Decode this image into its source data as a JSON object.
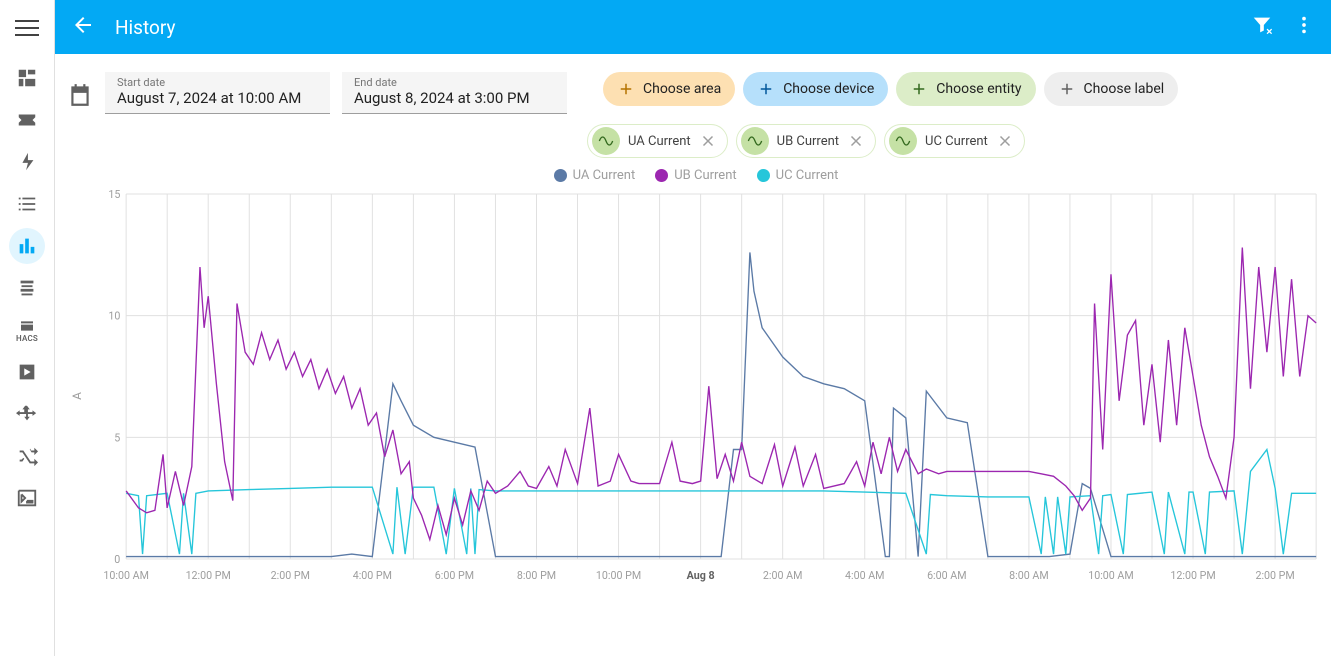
{
  "header": {
    "title": "History"
  },
  "dates": {
    "start_label": "Start date",
    "start_value": "August 7, 2024 at 10:00 AM",
    "end_label": "End date",
    "end_value": "August 8, 2024 at 3:00 PM"
  },
  "filters": {
    "area": "Choose area",
    "device": "Choose device",
    "entity": "Choose entity",
    "label": "Choose label"
  },
  "entity_chips": [
    "UA Current",
    "UB Current",
    "UC Current"
  ],
  "legend": [
    {
      "label": "UA Current",
      "color": "#5b7aa6"
    },
    {
      "label": "UB Current",
      "color": "#9c27b0"
    },
    {
      "label": "UC Current",
      "color": "#26c6da"
    }
  ],
  "chart_data": {
    "type": "line",
    "ylabel": "A",
    "ylim": [
      0,
      15
    ],
    "yticks": [
      0,
      5,
      10,
      15
    ],
    "x_hours_start": 10,
    "x_hours_end": 39,
    "xticks": [
      {
        "h": 10,
        "label": "10:00 AM"
      },
      {
        "h": 12,
        "label": "12:00 PM"
      },
      {
        "h": 14,
        "label": "2:00 PM"
      },
      {
        "h": 16,
        "label": "4:00 PM"
      },
      {
        "h": 18,
        "label": "6:00 PM"
      },
      {
        "h": 20,
        "label": "8:00 PM"
      },
      {
        "h": 22,
        "label": "10:00 PM"
      },
      {
        "h": 24,
        "label": "Aug 8",
        "bold": true
      },
      {
        "h": 26,
        "label": "2:00 AM"
      },
      {
        "h": 28,
        "label": "4:00 AM"
      },
      {
        "h": 30,
        "label": "6:00 AM"
      },
      {
        "h": 32,
        "label": "8:00 AM"
      },
      {
        "h": 34,
        "label": "10:00 AM"
      },
      {
        "h": 36,
        "label": "12:00 PM"
      },
      {
        "h": 38,
        "label": "2:00 PM"
      }
    ],
    "series": [
      {
        "name": "UA Current",
        "color": "#5b7aa6",
        "data": [
          [
            10,
            0.1
          ],
          [
            15,
            0.1
          ],
          [
            15.5,
            0.2
          ],
          [
            16,
            0.1
          ],
          [
            16.5,
            7.2
          ],
          [
            16.7,
            6.5
          ],
          [
            17,
            5.5
          ],
          [
            17.5,
            5
          ],
          [
            18,
            4.8
          ],
          [
            18.5,
            4.6
          ],
          [
            19,
            0.1
          ],
          [
            24.5,
            0.1
          ],
          [
            24.8,
            4.5
          ],
          [
            25,
            4.5
          ],
          [
            25.2,
            12.6
          ],
          [
            25.3,
            11
          ],
          [
            25.5,
            9.5
          ],
          [
            26,
            8.3
          ],
          [
            26.5,
            7.5
          ],
          [
            27,
            7.2
          ],
          [
            27.5,
            7
          ],
          [
            28,
            6.5
          ],
          [
            28.5,
            0.1
          ],
          [
            28.6,
            0.1
          ],
          [
            28.7,
            6.2
          ],
          [
            29,
            5.8
          ],
          [
            29.3,
            0.1
          ],
          [
            29.5,
            6.9
          ],
          [
            30,
            5.8
          ],
          [
            30.5,
            5.6
          ],
          [
            31,
            0.1
          ],
          [
            32.5,
            0.1
          ],
          [
            33,
            0.2
          ],
          [
            33.3,
            3.1
          ],
          [
            33.5,
            2.9
          ],
          [
            34,
            0.1
          ],
          [
            39,
            0.1
          ]
        ]
      },
      {
        "name": "UC Current",
        "color": "#26c6da",
        "data": [
          [
            10,
            2.7
          ],
          [
            10.3,
            2.6
          ],
          [
            10.4,
            0.2
          ],
          [
            10.5,
            2.6
          ],
          [
            11,
            2.7
          ],
          [
            11.3,
            0.2
          ],
          [
            11.4,
            2.7
          ],
          [
            11.6,
            0.2
          ],
          [
            11.7,
            2.7
          ],
          [
            12,
            2.8
          ],
          [
            13,
            2.85
          ],
          [
            14,
            2.9
          ],
          [
            15,
            2.95
          ],
          [
            16,
            2.95
          ],
          [
            16.5,
            0.2
          ],
          [
            16.6,
            2.95
          ],
          [
            16.8,
            0.2
          ],
          [
            17,
            2.95
          ],
          [
            17.5,
            2.95
          ],
          [
            17.8,
            0.2
          ],
          [
            18,
            2.9
          ],
          [
            18.3,
            0.2
          ],
          [
            18.4,
            2.9
          ],
          [
            18.5,
            0.2
          ],
          [
            18.6,
            2.85
          ],
          [
            19,
            2.8
          ],
          [
            20,
            2.8
          ],
          [
            21,
            2.8
          ],
          [
            22,
            2.8
          ],
          [
            23,
            2.8
          ],
          [
            24,
            2.8
          ],
          [
            25,
            2.8
          ],
          [
            26,
            2.8
          ],
          [
            27,
            2.8
          ],
          [
            28,
            2.75
          ],
          [
            29,
            2.7
          ],
          [
            29.5,
            0.2
          ],
          [
            29.6,
            2.65
          ],
          [
            30,
            2.6
          ],
          [
            31,
            2.55
          ],
          [
            32,
            2.55
          ],
          [
            32.3,
            0.2
          ],
          [
            32.4,
            2.55
          ],
          [
            32.6,
            0.2
          ],
          [
            32.7,
            2.55
          ],
          [
            32.9,
            0.2
          ],
          [
            33,
            2.55
          ],
          [
            33.5,
            2.6
          ],
          [
            33.7,
            0.2
          ],
          [
            33.8,
            2.6
          ],
          [
            34,
            2.65
          ],
          [
            34.3,
            0.2
          ],
          [
            34.4,
            2.65
          ],
          [
            35,
            2.75
          ],
          [
            35.3,
            0.2
          ],
          [
            35.4,
            2.75
          ],
          [
            35.8,
            0.2
          ],
          [
            35.9,
            2.75
          ],
          [
            36,
            2.75
          ],
          [
            36.3,
            0.2
          ],
          [
            36.4,
            2.75
          ],
          [
            37,
            2.8
          ],
          [
            37.2,
            0.2
          ],
          [
            37.4,
            3.6
          ],
          [
            37.8,
            4.5
          ],
          [
            38,
            2.9
          ],
          [
            38.2,
            0.2
          ],
          [
            38.4,
            2.7
          ],
          [
            39,
            2.7
          ]
        ]
      },
      {
        "name": "UB Current",
        "color": "#9c27b0",
        "data": [
          [
            10,
            2.8
          ],
          [
            10.3,
            2.1
          ],
          [
            10.5,
            1.9
          ],
          [
            10.7,
            2.0
          ],
          [
            10.9,
            4.3
          ],
          [
            11,
            2.1
          ],
          [
            11.2,
            3.6
          ],
          [
            11.4,
            2.2
          ],
          [
            11.6,
            3.8
          ],
          [
            11.8,
            12.0
          ],
          [
            11.9,
            9.5
          ],
          [
            12,
            10.8
          ],
          [
            12.2,
            7.2
          ],
          [
            12.4,
            4.0
          ],
          [
            12.6,
            2.4
          ],
          [
            12.7,
            10.5
          ],
          [
            12.9,
            8.5
          ],
          [
            13.1,
            8.0
          ],
          [
            13.3,
            9.3
          ],
          [
            13.5,
            8.2
          ],
          [
            13.7,
            9.0
          ],
          [
            13.9,
            7.8
          ],
          [
            14.1,
            8.5
          ],
          [
            14.3,
            7.5
          ],
          [
            14.5,
            8.2
          ],
          [
            14.7,
            7.0
          ],
          [
            14.9,
            7.8
          ],
          [
            15.1,
            6.8
          ],
          [
            15.3,
            7.5
          ],
          [
            15.5,
            6.2
          ],
          [
            15.7,
            7.0
          ],
          [
            15.9,
            5.5
          ],
          [
            16.1,
            6.0
          ],
          [
            16.3,
            4.2
          ],
          [
            16.5,
            5.3
          ],
          [
            16.7,
            3.5
          ],
          [
            16.9,
            4.0
          ],
          [
            17,
            2.5
          ],
          [
            17.2,
            1.8
          ],
          [
            17.4,
            0.8
          ],
          [
            17.6,
            2.2
          ],
          [
            17.8,
            1.0
          ],
          [
            18,
            2.5
          ],
          [
            18.2,
            1.4
          ],
          [
            18.4,
            2.8
          ],
          [
            18.6,
            2.0
          ],
          [
            18.8,
            3.2
          ],
          [
            19,
            2.7
          ],
          [
            19.3,
            3.0
          ],
          [
            19.6,
            3.6
          ],
          [
            19.8,
            3.0
          ],
          [
            20,
            2.9
          ],
          [
            20.3,
            3.8
          ],
          [
            20.5,
            3.0
          ],
          [
            20.7,
            4.5
          ],
          [
            21,
            3.1
          ],
          [
            21.3,
            6.2
          ],
          [
            21.5,
            3.0
          ],
          [
            21.8,
            3.2
          ],
          [
            22,
            4.3
          ],
          [
            22.3,
            3.2
          ],
          [
            22.5,
            3.1
          ],
          [
            23,
            3.1
          ],
          [
            23.3,
            4.8
          ],
          [
            23.5,
            3.2
          ],
          [
            23.8,
            3.1
          ],
          [
            24,
            3.2
          ],
          [
            24.2,
            7.1
          ],
          [
            24.4,
            3.3
          ],
          [
            24.6,
            4.3
          ],
          [
            24.8,
            3.2
          ],
          [
            25,
            4.8
          ],
          [
            25.2,
            3.4
          ],
          [
            25.5,
            3.1
          ],
          [
            25.8,
            4.7
          ],
          [
            26,
            3.0
          ],
          [
            26.3,
            4.6
          ],
          [
            26.5,
            3.0
          ],
          [
            26.8,
            4.3
          ],
          [
            27,
            2.9
          ],
          [
            27.5,
            3.1
          ],
          [
            27.8,
            4.0
          ],
          [
            28,
            3.0
          ],
          [
            28.2,
            4.8
          ],
          [
            28.4,
            3.5
          ],
          [
            28.6,
            5.0
          ],
          [
            28.8,
            3.6
          ],
          [
            29,
            4.5
          ],
          [
            29.3,
            3.5
          ],
          [
            29.5,
            3.7
          ],
          [
            29.8,
            3.5
          ],
          [
            30,
            3.6
          ],
          [
            30.5,
            3.6
          ],
          [
            31,
            3.6
          ],
          [
            31.5,
            3.6
          ],
          [
            32,
            3.6
          ],
          [
            32.3,
            3.5
          ],
          [
            32.6,
            3.4
          ],
          [
            32.9,
            3.0
          ],
          [
            33.1,
            2.6
          ],
          [
            33.3,
            2.0
          ],
          [
            33.5,
            2.5
          ],
          [
            33.6,
            10.5
          ],
          [
            33.8,
            4.5
          ],
          [
            34,
            11.7
          ],
          [
            34.2,
            6.5
          ],
          [
            34.4,
            9.2
          ],
          [
            34.6,
            9.8
          ],
          [
            34.8,
            5.5
          ],
          [
            35,
            8.0
          ],
          [
            35.2,
            4.8
          ],
          [
            35.4,
            9.0
          ],
          [
            35.6,
            5.5
          ],
          [
            35.8,
            9.5
          ],
          [
            36,
            7.5
          ],
          [
            36.2,
            5.5
          ],
          [
            36.4,
            4.2
          ],
          [
            36.6,
            3.4
          ],
          [
            36.8,
            2.5
          ],
          [
            37,
            5.0
          ],
          [
            37.2,
            12.8
          ],
          [
            37.4,
            7.0
          ],
          [
            37.6,
            12.0
          ],
          [
            37.8,
            8.5
          ],
          [
            38,
            12.0
          ],
          [
            38.2,
            7.5
          ],
          [
            38.4,
            11.5
          ],
          [
            38.6,
            7.5
          ],
          [
            38.8,
            10.0
          ],
          [
            39,
            9.7
          ]
        ]
      }
    ]
  }
}
